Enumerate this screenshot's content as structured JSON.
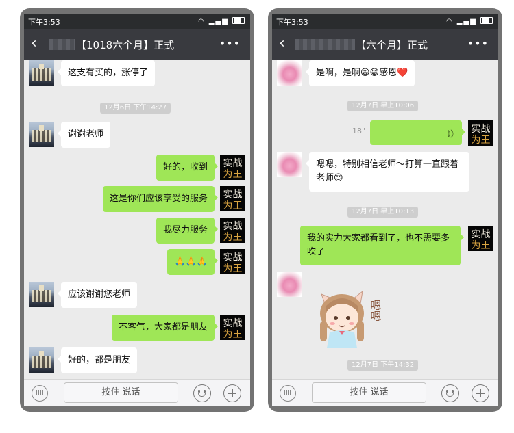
{
  "colors": {
    "title_bar": "#393a3f",
    "status_bar": "#2a2c2e",
    "chat_bg": "#ebebeb",
    "sent_bubble": "#9fe657",
    "received_bubble": "#ffffff",
    "timestamp_bg": "#cecece"
  },
  "left": {
    "status": {
      "time": "下午3:53",
      "icons": "wifi signal battery"
    },
    "header": {
      "title": "【1018六个月】正式"
    },
    "messages": {
      "m1": "这支有买的，涨停了",
      "ts1": "12月6日 下午14:27",
      "m2": "谢谢老师",
      "m3": "好的，收到",
      "m4": "这是你们应该享受的服务",
      "m5": "我尽力服务",
      "m6": "🙏🙏🙏",
      "m7": "应该谢谢您老师",
      "m8": "不客气，大家都是朋友",
      "m9": "好的，都是朋友"
    },
    "input": {
      "hold_to_talk": "按住 说话"
    }
  },
  "right": {
    "status": {
      "time": "下午3:53",
      "icons": "wifi signal battery"
    },
    "header": {
      "title": "【六个月】正式"
    },
    "messages": {
      "m1": "是啊，是啊😁😁感恩❤️",
      "ts1": "12月7日 早上10:06",
      "voice_len": "18\"",
      "m2": "嗯嗯，特别相信老师～打算一直跟着老师😍",
      "ts2": "12月7日 早上10:13",
      "m3": "我的实力大家都看到了，也不需要多吹了",
      "sticker_text": "嗯嗯",
      "ts3": "12月7日 下午14:32"
    },
    "input": {
      "hold_to_talk": "按住 说话"
    }
  },
  "badge_avatar_text": "实战为王",
  "icons": [
    "back-icon",
    "more-icon",
    "keyboard-icon",
    "emoji-icon",
    "plus-icon",
    "voice-wave-icon"
  ]
}
